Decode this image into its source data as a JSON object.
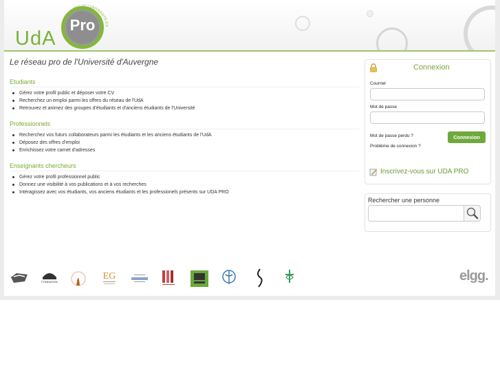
{
  "header": {
    "logo_text": "UdA",
    "logo_pro": "Pro",
    "logo_arc": "LE RÉSEAU PRO DE L'UNIVERSITÉ D'AUVERGNE"
  },
  "tagline": "Le réseau pro de l'Université d'Auvergne",
  "sections": [
    {
      "title": "Etudiants",
      "items": [
        "Gérez votre profil public et déposer votre CV",
        "Recherchez un emploi parmi les offres du réseau de l'UdA",
        "Retrouvez et animez des groupes d'étudiants et d'anciens étudiants de l'Université"
      ]
    },
    {
      "title": "Professionnels",
      "items": [
        "Recherchez vos futurs collaborateurs parmi les étudiants et les anciens étudiants de l'UdA",
        "Déposez des offres d'emploi",
        "Enrichissez votre carnet d'adresses"
      ]
    },
    {
      "title": "Enseignants chercheurs",
      "items": [
        "Gérez votre profil professionnel public",
        "Donnez une visibilité à vos publications et à vos recherches",
        "Intéragissez avec vos étudiants, vos anciens étudiants et les professionels présents sur UDA PRO"
      ]
    }
  ],
  "login": {
    "title": "Connexion",
    "email_label": "Courriel",
    "email_value": "",
    "password_label": "Mot de passe",
    "password_value": "",
    "forgot_link": "Mot de passe perdu ?",
    "problem_link": "Problème de connexion ?",
    "button_label": "Connexion",
    "register_link": "Inscrivez-vous sur UDA PRO"
  },
  "search": {
    "title": "Rechercher une personne",
    "value": ""
  },
  "partners": [
    "partner-logo-1",
    "fondation-logo",
    "partner-logo-3",
    "eg-logo",
    "partner-logo-5",
    "partner-logo-6",
    "partner-logo-7",
    "medecine-logo",
    "partner-logo-9",
    "pharmacie-logo"
  ],
  "partner_labels": {
    "fondation": "FONDATION",
    "eg": "EG"
  },
  "footer": {
    "powered_by": "elgg."
  },
  "colors": {
    "accent": "#79b23a",
    "button": "#6fa93e",
    "header_line": "#9dc56a"
  }
}
